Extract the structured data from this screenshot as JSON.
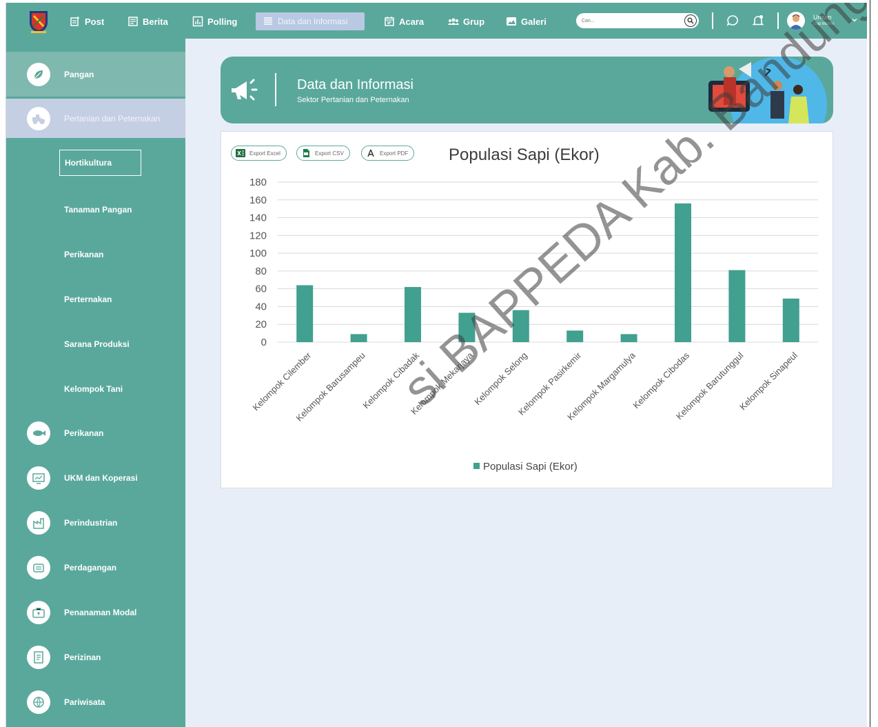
{
  "topbar": {
    "nav": [
      {
        "label": "Post",
        "icon": "post-icon"
      },
      {
        "label": "Berita",
        "icon": "news-icon"
      },
      {
        "label": "Polling",
        "icon": "poll-icon"
      },
      {
        "label": "Data dan Informasi",
        "icon": "data-icon"
      },
      {
        "label": "Acara",
        "icon": "calendar-icon"
      },
      {
        "label": "Grup",
        "icon": "group-icon"
      },
      {
        "label": "Galeri",
        "icon": "gallery-icon"
      }
    ],
    "search_placeholder": "Cari...",
    "user_name": "Umum",
    "user_sub": "Isap Marnu"
  },
  "sidebar": {
    "items": [
      {
        "label": "Pangan",
        "icon": "leaf-icon"
      },
      {
        "label": "Pertanian dan Peternakan",
        "icon": "farm-icon"
      },
      {
        "label": "Perikanan",
        "icon": "fish-icon"
      },
      {
        "label": "UKM dan Koperasi",
        "icon": "ukm-icon"
      },
      {
        "label": "Perindustrian",
        "icon": "factory-icon"
      },
      {
        "label": "Perdagangan",
        "icon": "trade-icon"
      },
      {
        "label": "Penanaman Modal",
        "icon": "investment-icon"
      },
      {
        "label": "Perizinan",
        "icon": "permit-icon"
      },
      {
        "label": "Pariwisata",
        "icon": "tourism-icon"
      }
    ],
    "subitems": [
      "Hortikultura",
      "Tanaman Pangan",
      "Perikanan",
      "Perternakan",
      "Sarana Produksi",
      "Kelompok Tani"
    ]
  },
  "banner": {
    "title": "Data dan Informasi",
    "subtitle": "Sektor Pertanian dan Peternakan"
  },
  "exports": [
    "Export Excel",
    "Export CSV",
    "Export PDF"
  ],
  "watermark": "si BAPPEDA Kab. Bandung",
  "colors": {
    "accent": "#5aa89c",
    "bar": "#41a090",
    "active_nav": "#b9c8e3"
  },
  "chart_data": {
    "type": "bar",
    "title": "Populasi Sapi (Ekor)",
    "categories": [
      "Kelompok Cilember",
      "Kelompok Barusampeu",
      "Kelompok Cibadak",
      "Kelompok Mekarjaya",
      "Kelompok Selong",
      "Kelompok Pasirkemir",
      "Kelompok Margamulya",
      "Kelompok Cibodas",
      "Kelompok Barutunggul",
      "Kelompok Sinapeul"
    ],
    "series": [
      {
        "name": "Populasi Sapi (Ekor)",
        "values": [
          64,
          9,
          62,
          33,
          36,
          13,
          9,
          156,
          81,
          49
        ]
      }
    ],
    "ylim": [
      0,
      180
    ],
    "yticks": [
      0,
      20,
      40,
      60,
      80,
      100,
      120,
      140,
      160,
      180
    ],
    "grid": true,
    "legend": "bottom"
  }
}
